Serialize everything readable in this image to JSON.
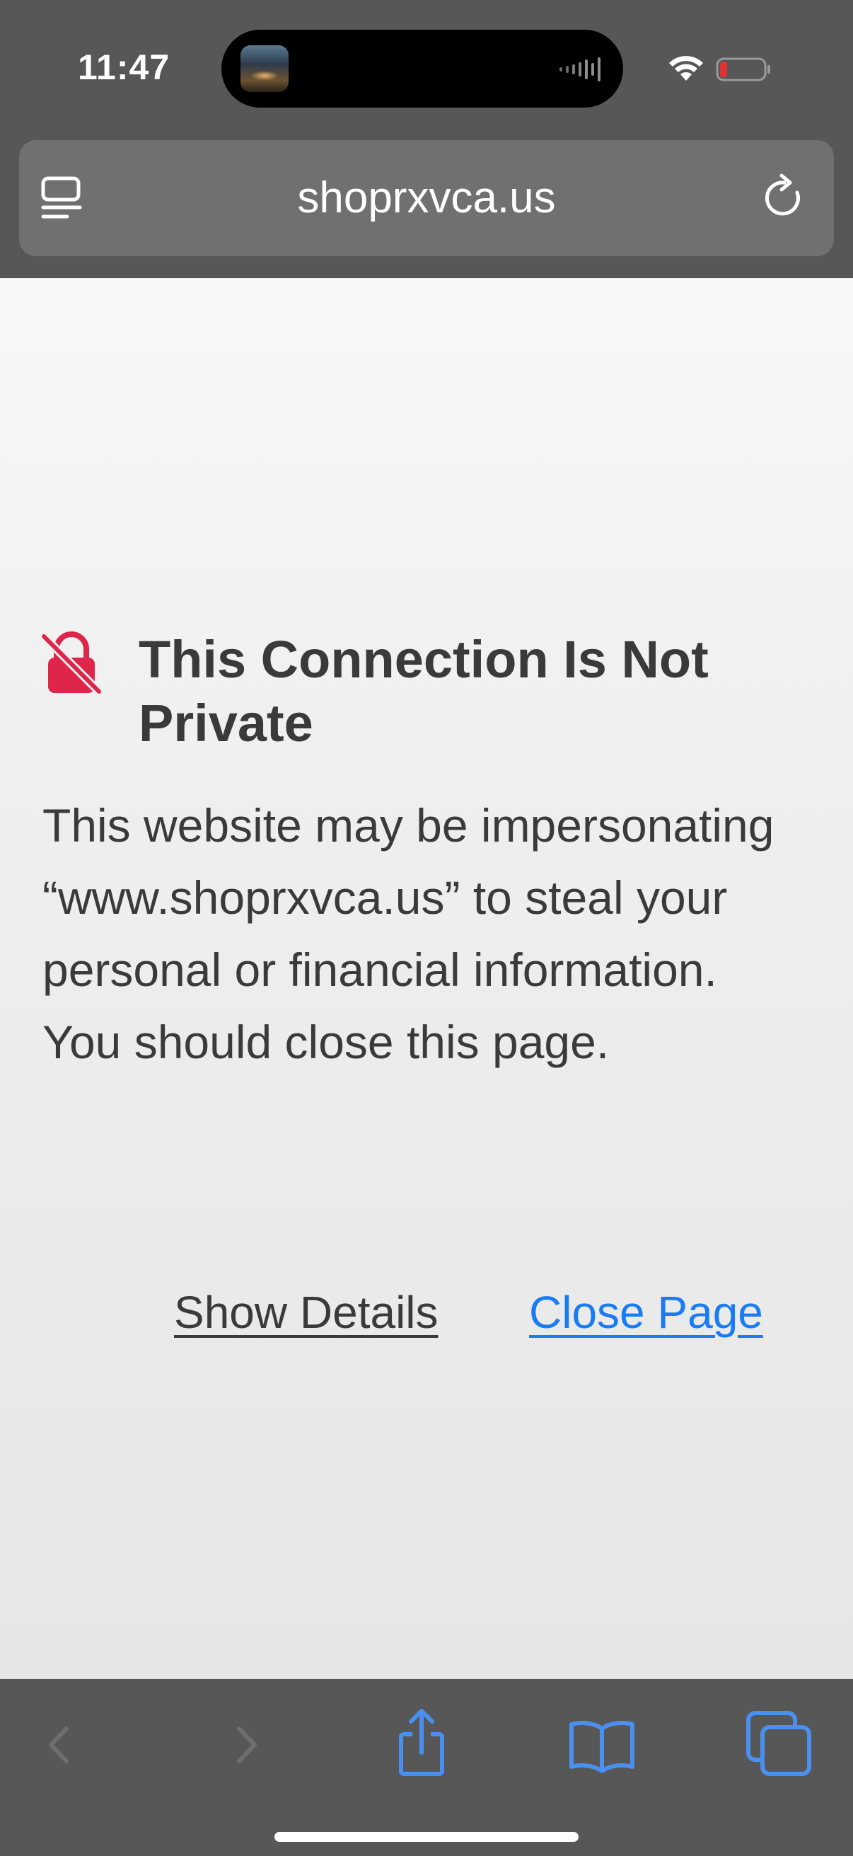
{
  "status_bar": {
    "time": "11:47",
    "battery_color": "#e0322f"
  },
  "browser": {
    "url": "shoprxvca.us"
  },
  "warning": {
    "title": "This Connection Is Not Private",
    "body": "This website may be impersonating “www.shoprxvca.us” to steal your personal or financial information. You should close this page.",
    "show_details_label": "Show Details",
    "close_page_label": "Close Page",
    "link_color": "#1a7cf2",
    "icon_color": "#e0254a"
  },
  "toolbar": {
    "icons": [
      "back-icon",
      "forward-icon",
      "share-icon",
      "bookmarks-icon",
      "tabs-icon"
    ],
    "accent_color": "#4a90f0"
  }
}
